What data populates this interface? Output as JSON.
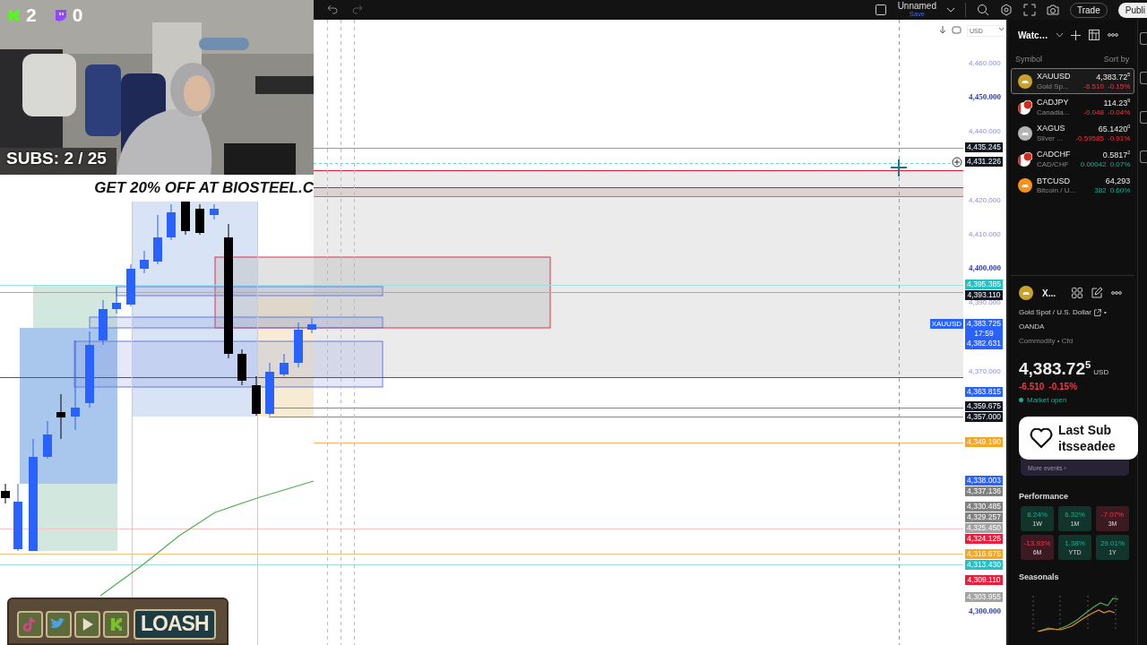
{
  "stream_overlay": {
    "kick_count": "2",
    "twitch_count": "0",
    "subs": "SUBS: 2 / 25",
    "banner": "GET 20% OFF AT BIOSTEEL.C",
    "badge_name": "LOASH",
    "alert": {
      "title": "Last Sub",
      "user": "itsseadee"
    }
  },
  "toolbar": {
    "layout_name": "Unnamed",
    "save_label": "Save",
    "trade_button": "Trade",
    "publish_button": "Publi"
  },
  "chart": {
    "currency": "USD",
    "symbol_tag": "XAUUSD",
    "price_axis": [
      {
        "text": "4,460.000",
        "kind": "tick"
      },
      {
        "text": "4,450.000",
        "kind": "major"
      },
      {
        "text": "4,440.000",
        "kind": "tick"
      },
      {
        "text": "4,435.245",
        "kind": "tag",
        "color": "#131722"
      },
      {
        "text": "4,431.226",
        "kind": "tag",
        "color": "#131722"
      },
      {
        "text": "4,420.000",
        "kind": "tick"
      },
      {
        "text": "4,410.000",
        "kind": "tick"
      },
      {
        "text": "4,400.000",
        "kind": "major"
      },
      {
        "text": "4,395.385",
        "kind": "tag",
        "color": "#22c1c3"
      },
      {
        "text": "4,393.110",
        "kind": "tag",
        "color": "#131722"
      },
      {
        "text": "4,390.000",
        "kind": "tick"
      },
      {
        "text": "4,383.725",
        "kind": "tag",
        "color": "#2962ff",
        "countdown": "17:59",
        "low": "4,382.631"
      },
      {
        "text": "4,370.000",
        "kind": "tick"
      },
      {
        "text": "4,363.815",
        "kind": "tag",
        "color": "#2962ff"
      },
      {
        "text": "4,359.675",
        "kind": "tag",
        "color": "#131722"
      },
      {
        "text": "4,357.000",
        "kind": "tag",
        "color": "#131722"
      },
      {
        "text": "4,349.190",
        "kind": "tag",
        "color": "#f5a623"
      },
      {
        "text": "4,338.003",
        "kind": "tag",
        "color": "#2962ff"
      },
      {
        "text": "4,337.136",
        "kind": "tag",
        "color": "#808080"
      },
      {
        "text": "4,330.485",
        "kind": "tag",
        "color": "#808080"
      },
      {
        "text": "4,329.257",
        "kind": "tag",
        "color": "#808080"
      },
      {
        "text": "4,325.450",
        "kind": "tag",
        "color": "#a3a3a3"
      },
      {
        "text": "4,324.125",
        "kind": "tag",
        "color": "#e91e3f"
      },
      {
        "text": "4,316.675",
        "kind": "tag",
        "color": "#f5a623"
      },
      {
        "text": "4,313.430",
        "kind": "tag",
        "color": "#22c1c3"
      },
      {
        "text": "4,309.110",
        "kind": "tag",
        "color": "#e91e3f"
      },
      {
        "text": "4,303.955",
        "kind": "tag",
        "color": "#a3a3a3"
      },
      {
        "text": "4,300.000",
        "kind": "major"
      }
    ]
  },
  "watchlist": {
    "title": "Watc…",
    "column": "Symbol",
    "sort": "Sort by",
    "rows": [
      {
        "symbol": "XAUUSD",
        "description": "Gold Sp...",
        "price": "4,383.72$^{5}$",
        "change": "-6.510",
        "percent": "-0.15%",
        "negative": true,
        "kind": "coin",
        "color": "#c9a227",
        "selected": true
      },
      {
        "symbol": "CADJPY",
        "description": "Canadia...",
        "price": "114.23$^{9}$",
        "change": "-0.048",
        "percent": "-0.04%",
        "negative": true,
        "kind": "flag",
        "selected": false
      },
      {
        "symbol": "XAGUS",
        "description": "Silver ...",
        "price": "65.1420$^{0}$",
        "change": "-0.59585",
        "percent": "-0.91%",
        "negative": true,
        "kind": "coin",
        "color": "#b5b5b5",
        "selected": false
      },
      {
        "symbol": "CADCHF",
        "description": "CAD/CHF",
        "price": "0.5817$^{2}$",
        "change": "0.00042",
        "percent": "0.07%",
        "negative": false,
        "kind": "flag",
        "selected": false
      },
      {
        "symbol": "BTCUSD",
        "description": "Bitcoin / U...",
        "price": "64,293",
        "change": "382",
        "percent": "0.60%",
        "negative": false,
        "kind": "coin",
        "color": "#f7931a",
        "selected": false
      }
    ]
  },
  "details": {
    "symbol": "X...",
    "name": "Gold Spot / U.S. Dollar",
    "separator": "•",
    "exchange": "OANDA",
    "category": "Commodity • Cfd",
    "price": "4,383.72$^{5}$",
    "currency": "USD",
    "change": "-6.510",
    "percent": "-0.15%",
    "status": "Market open",
    "more_events": "More events ›"
  },
  "performance": {
    "title": "Performance",
    "tiles": [
      {
        "value": "8.24%",
        "period": "1W",
        "negative": false
      },
      {
        "value": "6.32%",
        "period": "1M",
        "negative": false
      },
      {
        "value": "-7.07%",
        "period": "3M",
        "negative": true
      },
      {
        "value": "-13.93%",
        "period": "6M",
        "negative": true
      },
      {
        "value": "1.38%",
        "period": "YTD",
        "negative": false
      },
      {
        "value": "29.01%",
        "period": "1Y",
        "negative": false
      }
    ]
  },
  "seasonals": {
    "title": "Seasonals"
  }
}
